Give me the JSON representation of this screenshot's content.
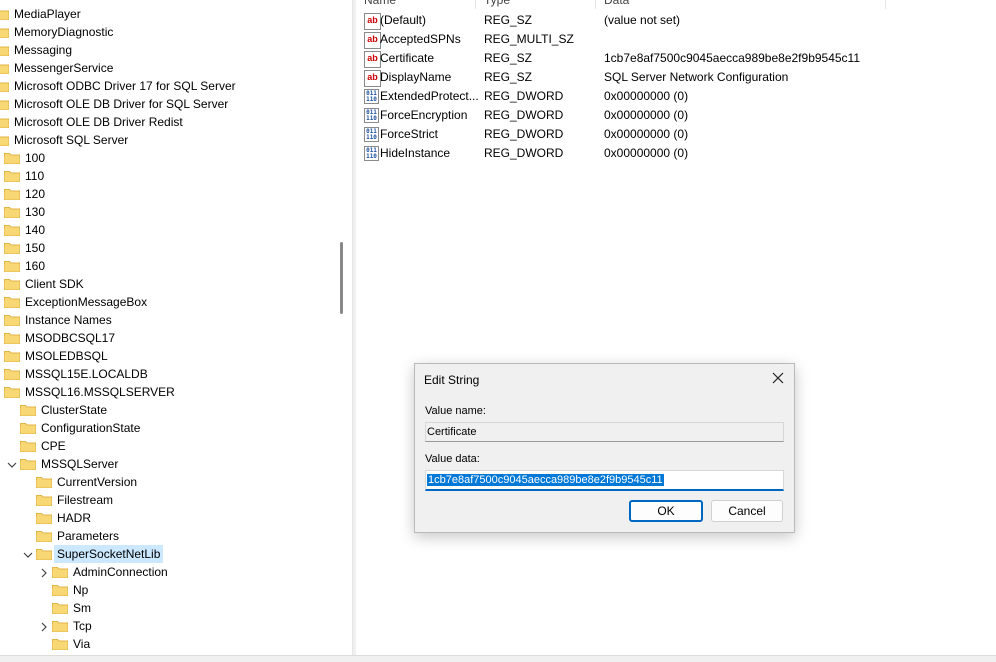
{
  "tree": {
    "items": [
      {
        "label": "MediaPlayer",
        "level": 0,
        "expander": "none"
      },
      {
        "label": "MemoryDiagnostic",
        "level": 0,
        "expander": "none"
      },
      {
        "label": "Messaging",
        "level": 0,
        "expander": "none"
      },
      {
        "label": "MessengerService",
        "level": 0,
        "expander": "none"
      },
      {
        "label": "Microsoft ODBC Driver 17 for SQL Server",
        "level": 0,
        "expander": "none"
      },
      {
        "label": "Microsoft OLE DB Driver for SQL Server",
        "level": 0,
        "expander": "none"
      },
      {
        "label": "Microsoft OLE DB Driver Redist",
        "level": 0,
        "expander": "none"
      },
      {
        "label": "Microsoft SQL Server",
        "level": 0,
        "expander": "none"
      },
      {
        "label": "100",
        "level": 1,
        "expander": "none"
      },
      {
        "label": "110",
        "level": 1,
        "expander": "none"
      },
      {
        "label": "120",
        "level": 1,
        "expander": "none"
      },
      {
        "label": "130",
        "level": 1,
        "expander": "none"
      },
      {
        "label": "140",
        "level": 1,
        "expander": "none"
      },
      {
        "label": "150",
        "level": 1,
        "expander": "none"
      },
      {
        "label": "160",
        "level": 1,
        "expander": "none"
      },
      {
        "label": "Client SDK",
        "level": 1,
        "expander": "none"
      },
      {
        "label": "ExceptionMessageBox",
        "level": 1,
        "expander": "none"
      },
      {
        "label": "Instance Names",
        "level": 1,
        "expander": "none"
      },
      {
        "label": "MSODBCSQL17",
        "level": 1,
        "expander": "none"
      },
      {
        "label": "MSOLEDBSQL",
        "level": 1,
        "expander": "none"
      },
      {
        "label": "MSSQL15E.LOCALDB",
        "level": 1,
        "expander": "none"
      },
      {
        "label": "MSSQL16.MSSQLSERVER",
        "level": 1,
        "expander": "none"
      },
      {
        "label": "ClusterState",
        "level": 2,
        "expander": "none"
      },
      {
        "label": "ConfigurationState",
        "level": 2,
        "expander": "none"
      },
      {
        "label": "CPE",
        "level": 2,
        "expander": "none"
      },
      {
        "label": "MSSQLServer",
        "level": 2,
        "expander": "expanded"
      },
      {
        "label": "CurrentVersion",
        "level": 3,
        "expander": "none"
      },
      {
        "label": "Filestream",
        "level": 3,
        "expander": "none"
      },
      {
        "label": "HADR",
        "level": 3,
        "expander": "none"
      },
      {
        "label": "Parameters",
        "level": 3,
        "expander": "none"
      },
      {
        "label": "SuperSocketNetLib",
        "level": 3,
        "expander": "expanded",
        "selected": true
      },
      {
        "label": "AdminConnection",
        "level": 4,
        "expander": "collapsed"
      },
      {
        "label": "Np",
        "level": 4,
        "expander": "none"
      },
      {
        "label": "Sm",
        "level": 4,
        "expander": "none"
      },
      {
        "label": "Tcp",
        "level": 4,
        "expander": "collapsed"
      },
      {
        "label": "Via",
        "level": 4,
        "expander": "none"
      }
    ]
  },
  "columns": {
    "name": "Name",
    "type": "Type",
    "data": "Data"
  },
  "values": [
    {
      "icon": "string-value-icon",
      "name": "(Default)",
      "type": "REG_SZ",
      "data": "(value not set)"
    },
    {
      "icon": "string-value-icon",
      "name": "AcceptedSPNs",
      "type": "REG_MULTI_SZ",
      "data": ""
    },
    {
      "icon": "string-value-icon",
      "name": "Certificate",
      "type": "REG_SZ",
      "data": "1cb7e8af7500c9045aecca989be8e2f9b9545c11"
    },
    {
      "icon": "string-value-icon",
      "name": "DisplayName",
      "type": "REG_SZ",
      "data": "SQL Server Network Configuration"
    },
    {
      "icon": "binary-value-icon",
      "name": "ExtendedProtect...",
      "type": "REG_DWORD",
      "data": "0x00000000 (0)"
    },
    {
      "icon": "binary-value-icon",
      "name": "ForceEncryption",
      "type": "REG_DWORD",
      "data": "0x00000000 (0)"
    },
    {
      "icon": "binary-value-icon",
      "name": "ForceStrict",
      "type": "REG_DWORD",
      "data": "0x00000000 (0)"
    },
    {
      "icon": "binary-value-icon",
      "name": "HideInstance",
      "type": "REG_DWORD",
      "data": "0x00000000 (0)"
    }
  ],
  "dialog": {
    "title": "Edit String",
    "value_name_label": "Value name:",
    "value_name": "Certificate",
    "value_data_label": "Value data:",
    "value_data": "1cb7e8af7500c9045aecca989be8e2f9b9545c11",
    "ok_label": "OK",
    "cancel_label": "Cancel"
  },
  "colors": {
    "folder": "#f8d775",
    "folder_dark": "#e0b545",
    "selection": "#cce8ff",
    "accent": "#0067c0"
  }
}
